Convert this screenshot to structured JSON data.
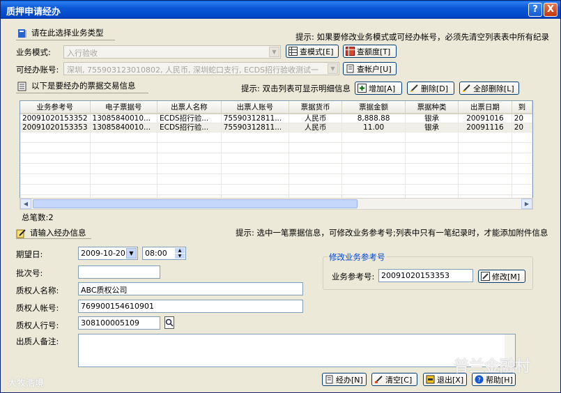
{
  "window": {
    "title": "质押申请经办",
    "help_btn": "?",
    "close_btn": "X"
  },
  "section1": {
    "heading": "请在此选择业务类型",
    "hint": "提示: 如果要修改业务模式或可经办帐号，必须先清空列表表中所有纪录"
  },
  "business_mode": {
    "label": "业务模式:",
    "value": "入行验收",
    "btn_query_mode": "查模式[E]",
    "btn_query_limit": "查额度[T]"
  },
  "account": {
    "label": "可经办账号:",
    "value": "深圳, 755903123010802, 人民币, 深圳蛇口支行, ECDS招行验收测试一",
    "btn_query_account": "查帐户[U]"
  },
  "section2": {
    "heading": "以下是要经办的票据交易信息",
    "hint": "提示: 双击列表可显示明细信息",
    "btn_add": "增加[A]",
    "btn_delete": "删除[D]",
    "btn_delete_all": "全部删除[L]"
  },
  "table": {
    "columns": [
      "业务参考号",
      "电子票据号",
      "出票人名称",
      "出票人账号",
      "票据货币",
      "票据金额",
      "票据种类",
      "出票日期",
      "到"
    ],
    "rows": [
      [
        "20091020153352",
        "13085840010...",
        "ECDS招行验...",
        "75590312811...",
        "人民币",
        "8,888.88",
        "银承",
        "20091016",
        "20"
      ],
      [
        "20091020153353",
        "13085840010...",
        "ECDS招行验...",
        "75590312811...",
        "人民币",
        "11.00",
        "银承",
        "20091116",
        "20"
      ]
    ],
    "total_label": "总笔数:2"
  },
  "section3": {
    "heading": "请输入经办信息",
    "hint": "提示: 选中一笔票据信息，可修改业务参考号;列表中只有一笔纪录时，才能添加附件信息"
  },
  "form": {
    "expected_date_label": "期望日:",
    "expected_date": "2009-10-20",
    "expected_time": "08:00",
    "batch_label": "批次号:",
    "batch_value": "",
    "pledgee_name_label": "质权人名称:",
    "pledgee_name": "ABC质权公司",
    "pledgee_account_label": "质权人帐号:",
    "pledgee_account": "769900154610901",
    "pledgee_bank_label": "质权人行号:",
    "pledgee_bank": "308100005109",
    "remark_label": "出质人备注:",
    "remark": ""
  },
  "modify_ref": {
    "legend": "修改业务参考号",
    "label": "业务参考号:",
    "value": "20091020153353",
    "btn": "修改[M]"
  },
  "footer": {
    "btn_submit": "经办[N]",
    "btn_clear": "清空[C]",
    "btn_exit": "退出[X]",
    "btn_help": "帮助[H]",
    "watermark_left": "大牧浩境",
    "watermark_right": "普兰金融村"
  }
}
